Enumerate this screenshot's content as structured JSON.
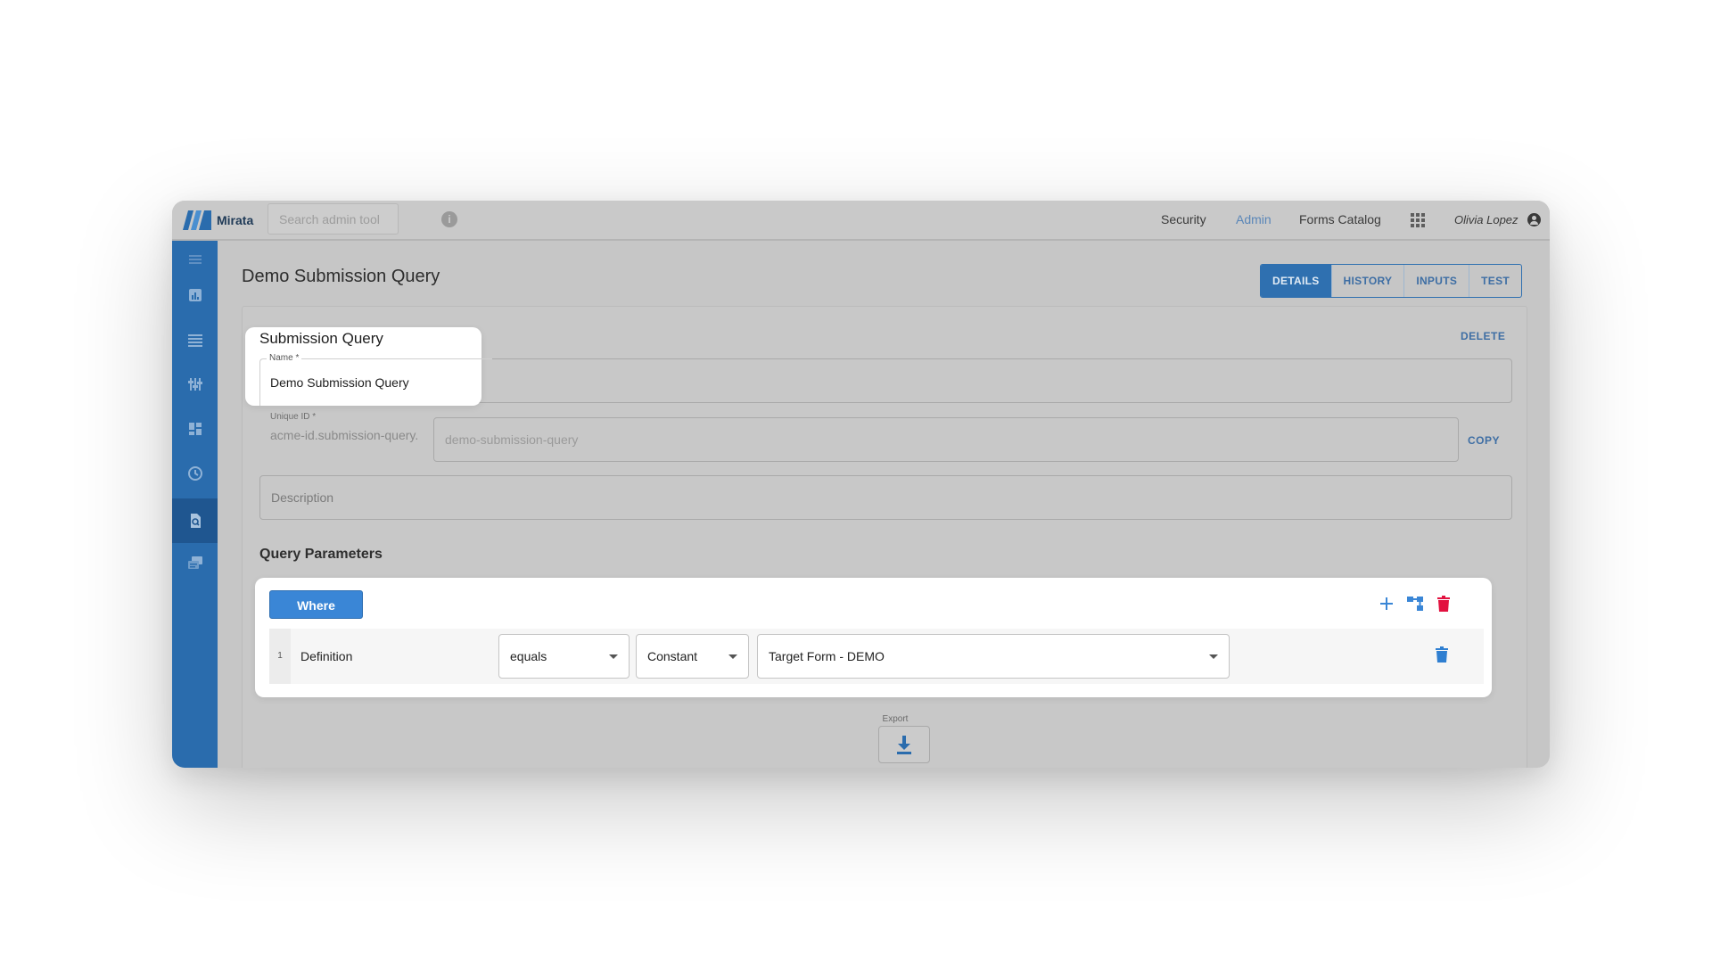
{
  "app": {
    "logo_text": "Mirata"
  },
  "header": {
    "search_placeholder": "Search admin tool",
    "nav": [
      {
        "label": "Security",
        "active": false
      },
      {
        "label": "Admin",
        "active": true
      },
      {
        "label": "Forms Catalog",
        "active": false
      }
    ],
    "user": "Olivia Lopez"
  },
  "sidebar": {
    "items": [
      {
        "icon": "menu-icon",
        "active": false
      },
      {
        "icon": "chart-icon",
        "active": false
      },
      {
        "icon": "list-icon",
        "active": false
      },
      {
        "icon": "sliders-icon",
        "active": false
      },
      {
        "icon": "dashboard-icon",
        "active": false
      },
      {
        "icon": "clock-icon",
        "active": false
      },
      {
        "icon": "search-document-icon",
        "active": true
      },
      {
        "icon": "forms-icon",
        "active": false
      }
    ]
  },
  "page": {
    "title": "Demo Submission Query",
    "tabs": [
      {
        "label": "DETAILS",
        "active": true
      },
      {
        "label": "HISTORY",
        "active": false
      },
      {
        "label": "INPUTS",
        "active": false
      },
      {
        "label": "TEST",
        "active": false
      }
    ],
    "delete_label": "DELETE"
  },
  "form": {
    "section_title": "Submission Query",
    "name_label": "Name *",
    "name_value": "Demo Submission Query",
    "unique_id_label": "Unique ID *",
    "unique_id_prefix": "acme-id.submission-query.",
    "unique_id_value": "demo-submission-query",
    "copy_label": "COPY",
    "description_placeholder": "Description"
  },
  "query": {
    "title": "Query Parameters",
    "where_label": "Where",
    "rows": [
      {
        "index": "1",
        "field": "Definition",
        "operator": "equals",
        "value_type": "Constant",
        "value": "Target Form - DEMO"
      }
    ]
  },
  "export": {
    "label": "Export"
  },
  "colors": {
    "primary": "#3a86d6",
    "sidebar": "#2a6cad",
    "danger": "#e2113f"
  }
}
